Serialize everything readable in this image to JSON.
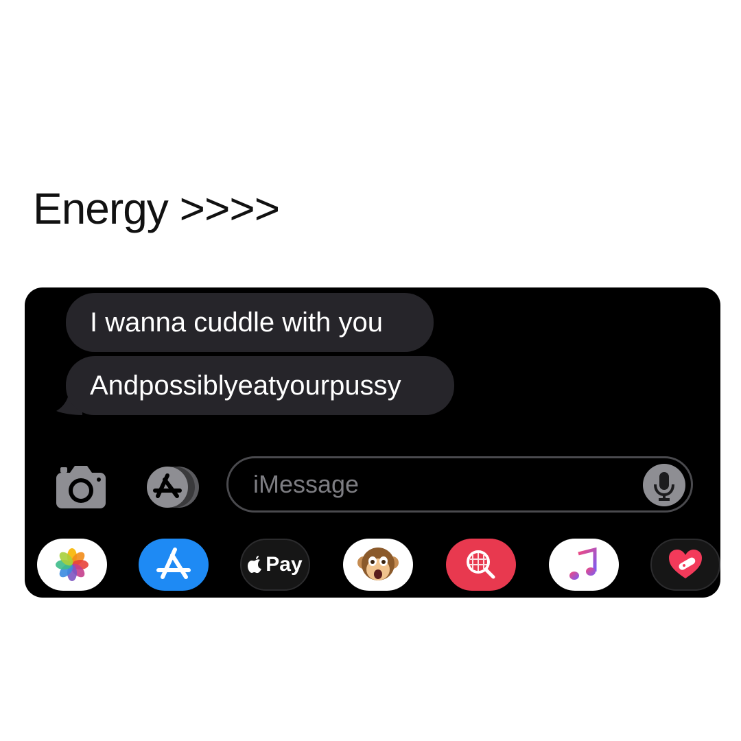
{
  "caption": "Energy >>>>",
  "messages": [
    {
      "text": "I wanna cuddle with you",
      "direction": "incoming"
    },
    {
      "text": "Andpossiblyeatyourpussy",
      "direction": "incoming"
    }
  ],
  "composer": {
    "placeholder": "iMessage",
    "icons": [
      "camera-icon",
      "app-store-icon",
      "microphone-icon"
    ]
  },
  "app_drawer": {
    "apps": [
      {
        "name": "photos-app-icon"
      },
      {
        "name": "app-store-app-icon"
      },
      {
        "name": "apple-pay-app-icon",
        "label": "Pay"
      },
      {
        "name": "animoji-app-icon"
      },
      {
        "name": "image-search-app-icon"
      },
      {
        "name": "music-app-icon"
      },
      {
        "name": "digital-touch-app-icon"
      }
    ]
  },
  "colors": {
    "panel_bg": "#000000",
    "bubble_bg": "#26252a",
    "app_store_blue": "#1e8af4",
    "search_red": "#e8394f"
  }
}
